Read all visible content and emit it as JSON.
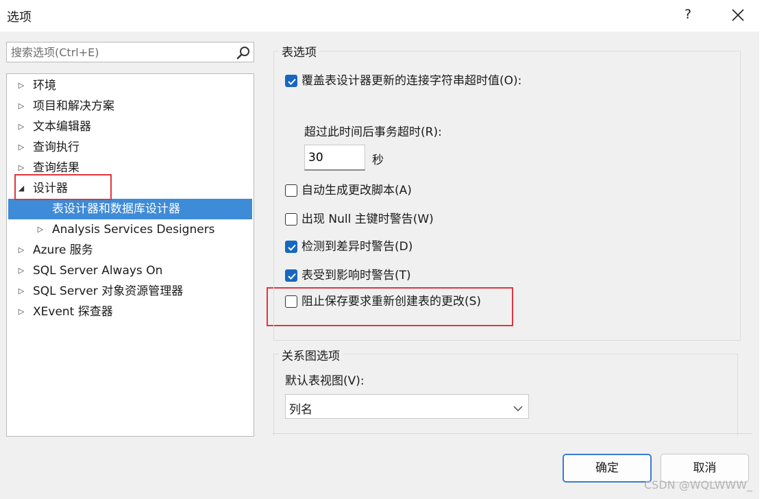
{
  "window": {
    "title": "选项",
    "help_label": "?"
  },
  "search": {
    "placeholder": "搜索选项(Ctrl+E)"
  },
  "tree": {
    "items": [
      {
        "label": "环境",
        "expanded": false
      },
      {
        "label": "项目和解决方案",
        "expanded": false
      },
      {
        "label": "文本编辑器",
        "expanded": false
      },
      {
        "label": "查询执行",
        "expanded": false
      },
      {
        "label": "查询结果",
        "expanded": false
      },
      {
        "label": "设计器",
        "expanded": true
      },
      {
        "label": "表设计器和数据库设计器",
        "selected": true
      },
      {
        "label": "Analysis Services Designers",
        "expanded": false
      },
      {
        "label": "Azure 服务",
        "expanded": false
      },
      {
        "label": "SQL Server Always On",
        "expanded": false
      },
      {
        "label": "SQL Server 对象资源管理器",
        "expanded": false
      },
      {
        "label": "XEvent 探查器",
        "expanded": false
      }
    ]
  },
  "table_options": {
    "title": "表选项",
    "override_timeout": {
      "label": "覆盖表设计器更新的连接字符串超时值(O):",
      "checked": true
    },
    "timeout_label": "超过此时间后事务超时(R):",
    "timeout_value": "30",
    "timeout_unit": "秒",
    "auto_script": {
      "label": "自动生成更改脚本(A)",
      "checked": false
    },
    "null_warning": {
      "label": "出现 Null 主键时警告(W)",
      "checked": false
    },
    "diff_warning": {
      "label": "检测到差异时警告(D)",
      "checked": true
    },
    "affected_warning": {
      "label": "表受到影响时警告(T)",
      "checked": true
    },
    "prevent_recreate": {
      "label": "阻止保存要求重新创建表的更改(S)",
      "checked": false
    }
  },
  "diagram_options": {
    "title": "关系图选项",
    "default_view_label": "默认表视图(V):",
    "default_view_value": "列名"
  },
  "buttons": {
    "ok": "确定",
    "cancel": "取消"
  },
  "watermark": "CSDN @WQLWWW_",
  "colors": {
    "accent": "#1767c1",
    "selection": "#3e8bd7",
    "highlight_box": "#e0353c"
  }
}
